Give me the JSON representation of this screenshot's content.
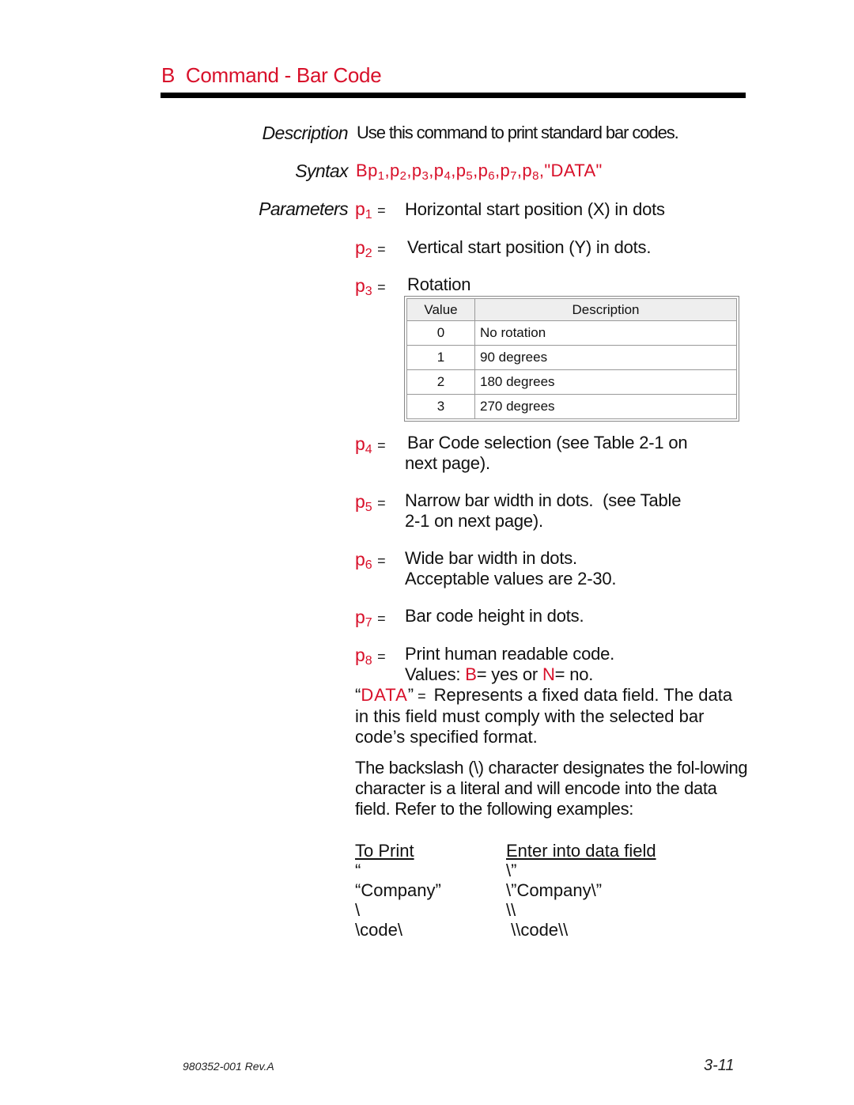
{
  "header": {
    "title": "B  Command - Bar Code"
  },
  "description": {
    "label": "Description",
    "text": "Use this command to print standard bar codes."
  },
  "syntax": {
    "label": "Syntax",
    "prefix": "Bp",
    "params": [
      {
        "p": "p",
        "n": "1"
      },
      {
        "p": "p",
        "n": "2"
      },
      {
        "p": "p",
        "n": "3"
      },
      {
        "p": "p",
        "n": "4"
      },
      {
        "p": "p",
        "n": "5"
      },
      {
        "p": "p",
        "n": "6"
      },
      {
        "p": "p",
        "n": "7"
      },
      {
        "p": "p",
        "n": "8"
      }
    ],
    "suffix": "\"DATA\""
  },
  "parameters": {
    "label": "Parameters",
    "equals": "=",
    "items": [
      {
        "name": "p",
        "sub": "1",
        "lines": [
          "Horizontal start position (X) in dots"
        ]
      },
      {
        "name": "p",
        "sub": "2",
        "lines": [
          "Vertical start position (Y) in dots."
        ]
      },
      {
        "name": "p",
        "sub": "3",
        "lines": [
          "Rotation"
        ]
      },
      {
        "name": "p",
        "sub": "4",
        "lines": [
          "Bar Code selection (see Table 2-1 on",
          "next page)."
        ]
      },
      {
        "name": "p",
        "sub": "5",
        "lines": [
          "Narrow bar width in dots.  (see Table",
          "2-1 on next page)."
        ]
      },
      {
        "name": "p",
        "sub": "6",
        "lines": [
          "Wide bar width in dots.",
          "Acceptable values are 2-30."
        ]
      },
      {
        "name": "p",
        "sub": "7",
        "lines": [
          "Bar code height in dots."
        ]
      },
      {
        "name": "p",
        "sub": "8",
        "lines": [
          "Print human readable code."
        ]
      }
    ],
    "p8_values": {
      "prefix": "Values: ",
      "b": "B",
      "b_text": "= yes or ",
      "n": "N",
      "n_text": "= no."
    }
  },
  "rotation_table": {
    "headers": [
      "Value",
      "Description"
    ],
    "rows": [
      [
        "0",
        "No rotation"
      ],
      [
        "1",
        "90 degrees"
      ],
      [
        "2",
        "180 degrees"
      ],
      [
        "3",
        "270 degrees"
      ]
    ]
  },
  "data_field": {
    "open_quote": "“",
    "name": "DATA",
    "close_quote": "”",
    "equals": " =  ",
    "text_first": "Represents a fixed data field. The",
    "text_rest": "data in this field must comply with the selected bar code’s specified format."
  },
  "backslash_paragraph": "The backslash (\\) character designates the fol-lowing character is a literal and will encode into the data field. Refer to the following examples:",
  "examples": {
    "headers": [
      "To Print",
      "Enter into data field"
    ],
    "rows": [
      [
        "“",
        "\\”"
      ],
      [
        "“Company”",
        "\\”Company\\”"
      ],
      [
        "\\",
        "\\\\"
      ],
      [
        "\\code\\",
        " \\\\code\\\\"
      ]
    ]
  },
  "footer": {
    "doc_number": "980352-001 Rev.A",
    "page_number": "3-11"
  },
  "colors": {
    "accent": "#d8102a",
    "text": "#111111",
    "rule": "#000000",
    "table_header_bg": "#eeeeee"
  }
}
